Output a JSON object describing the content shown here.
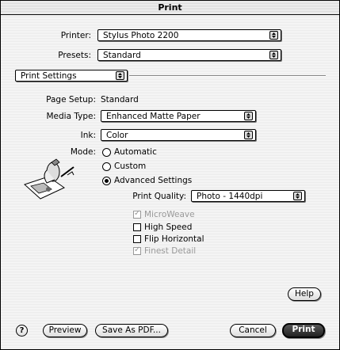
{
  "window": {
    "title": "Print"
  },
  "printer": {
    "label": "Printer:",
    "value": "Stylus Photo 2200"
  },
  "presets": {
    "label": "Presets:",
    "value": "Standard"
  },
  "panel": {
    "value": "Print Settings"
  },
  "page_setup": {
    "label": "Page Setup:",
    "value": "Standard"
  },
  "media_type": {
    "label": "Media Type:",
    "value": "Enhanced Matte Paper"
  },
  "ink": {
    "label": "Ink:",
    "value": "Color"
  },
  "mode": {
    "label": "Mode:",
    "options": [
      "Automatic",
      "Custom",
      "Advanced Settings"
    ],
    "selected": "Advanced Settings"
  },
  "print_quality": {
    "label": "Print Quality:",
    "value": "Photo - 1440dpi"
  },
  "checkboxes": {
    "microweave": {
      "label": "MicroWeave",
      "checked": true,
      "enabled": false
    },
    "high_speed": {
      "label": "High Speed",
      "checked": false,
      "enabled": true
    },
    "flip_horizontal": {
      "label": "Flip Horizontal",
      "checked": false,
      "enabled": true
    },
    "finest_detail": {
      "label": "Finest Detail",
      "checked": true,
      "enabled": false
    }
  },
  "buttons": {
    "help": "Help",
    "question": "?",
    "preview": "Preview",
    "save_pdf": "Save As PDF...",
    "cancel": "Cancel",
    "print": "Print"
  },
  "icons": {
    "mode_illustration": "hand-with-pen-icon",
    "popup_arrows": "up-down-arrows-icon"
  }
}
